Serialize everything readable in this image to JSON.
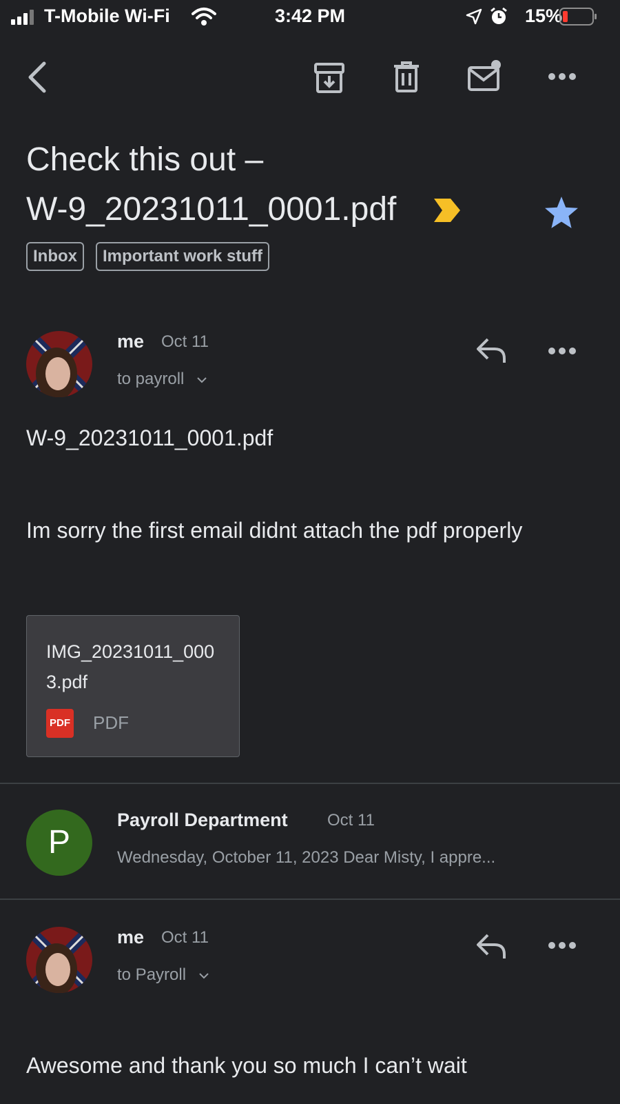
{
  "status_bar": {
    "carrier": "T-Mobile Wi-Fi",
    "time": "3:42 PM",
    "battery": "15%"
  },
  "subject": {
    "line1": "Check this out –",
    "line2": "W-9_20231011_0001.pdf"
  },
  "labels": [
    "Inbox",
    "Important work stuff"
  ],
  "messages": [
    {
      "sender": "me",
      "date": "Oct 11",
      "recipient": "to payroll",
      "body_title": "W-9_20231011_0001.pdf",
      "body": "Im sorry the first email didnt attach the pdf properly",
      "attachment": {
        "name": "IMG_20231011_0003.pdf",
        "badge": "PDF",
        "type": "PDF"
      }
    },
    {
      "sender": "Payroll Department",
      "avatar_letter": "P",
      "date": "Oct 11",
      "snippet": "Wednesday, October 11, 2023 Dear Misty, I appre..."
    },
    {
      "sender": "me",
      "date": "Oct 11",
      "recipient": "to Payroll",
      "body": "Awesome and thank you so much I can’t wait"
    }
  ],
  "colors": {
    "background": "#202124",
    "star": "#8ab4f8",
    "importance_marker": "#f6bf26",
    "avatar_p": "#33691e"
  }
}
